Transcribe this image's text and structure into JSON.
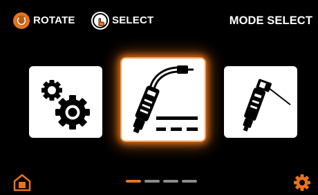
{
  "header": {
    "rotate_label": "ROTATE",
    "select_label": "SELECT",
    "title": "MODE SELECT"
  },
  "modes": [
    {
      "icon": "gears-icon",
      "selected": false
    },
    {
      "icon": "mig-torch-icon",
      "selected": true
    },
    {
      "icon": "tig-torch-icon",
      "selected": false
    }
  ],
  "pagination": {
    "pages": 4,
    "current": 1
  },
  "footer": {
    "left_icon": "home-icon",
    "right_icon": "gear-icon"
  },
  "colors": {
    "accent": "#e8741a",
    "background": "#000000",
    "card": "#ffffff",
    "inactive_dot": "#8a8a8a"
  }
}
